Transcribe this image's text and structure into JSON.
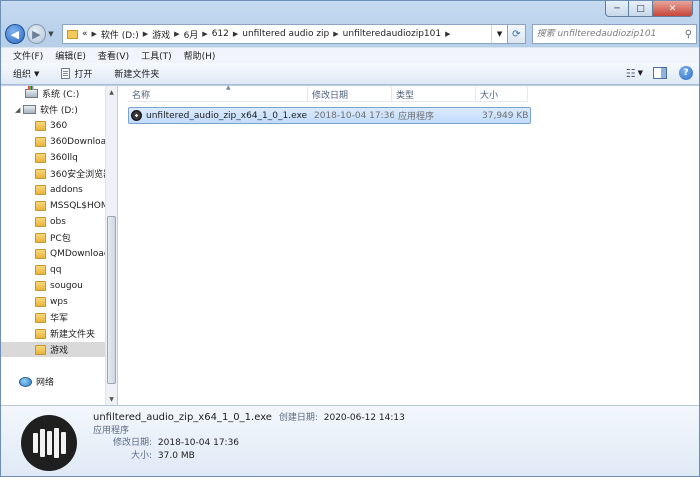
{
  "window": {
    "caption": {
      "minimize": "─",
      "maximize": "□",
      "close": "✕"
    }
  },
  "address": {
    "overflow": "«",
    "crumbs": [
      "软件 (D:)",
      "游戏",
      "6月",
      "612",
      "unfiltered audio zip",
      "unfilteredaudiozip101"
    ],
    "search_placeholder": "搜索 unfilteredaudiozip101"
  },
  "menu": {
    "items": [
      "文件(F)",
      "编辑(E)",
      "查看(V)",
      "工具(T)",
      "帮助(H)"
    ]
  },
  "toolbar": {
    "organize": "组织",
    "open": "打开",
    "new_folder": "新建文件夹"
  },
  "nav": {
    "items": [
      {
        "label": "系统 (C:)",
        "kind": "drive-sys",
        "selected": false
      },
      {
        "label": "软件 (D:)",
        "kind": "drive",
        "selected": false
      },
      {
        "label": "360",
        "kind": "folder",
        "selected": false
      },
      {
        "label": "360Downloads",
        "kind": "folder",
        "selected": false
      },
      {
        "label": "360llq",
        "kind": "folder",
        "selected": false
      },
      {
        "label": "360安全浏览器",
        "kind": "folder",
        "selected": false
      },
      {
        "label": "addons",
        "kind": "folder",
        "selected": false
      },
      {
        "label": "MSSQL$HOME",
        "kind": "folder",
        "selected": false
      },
      {
        "label": "obs",
        "kind": "folder",
        "selected": false
      },
      {
        "label": "PC包",
        "kind": "folder",
        "selected": false
      },
      {
        "label": "QMDownload",
        "kind": "folder",
        "selected": false
      },
      {
        "label": "qq",
        "kind": "folder",
        "selected": false
      },
      {
        "label": "sougou",
        "kind": "folder",
        "selected": false
      },
      {
        "label": "wps",
        "kind": "folder",
        "selected": false
      },
      {
        "label": "华军",
        "kind": "folder",
        "selected": false
      },
      {
        "label": "新建文件夹",
        "kind": "folder",
        "selected": false
      },
      {
        "label": "游戏",
        "kind": "folder",
        "selected": true
      },
      {
        "label": "网络",
        "kind": "network",
        "selected": false
      }
    ]
  },
  "columns": {
    "name": "名称",
    "modified": "修改日期",
    "type": "类型",
    "size": "大小"
  },
  "files": [
    {
      "name": "unfiltered_audio_zip_x64_1_0_1.exe",
      "modified": "2018-10-04 17:36",
      "type": "应用程序",
      "size": "37,949 KB"
    }
  ],
  "details": {
    "filename": "unfiltered_audio_zip_x64_1_0_1.exe",
    "created_label": "创建日期:",
    "created_value": "2020-06-12 14:13",
    "type": "应用程序",
    "modified_label": "修改日期:",
    "modified_value": "2018-10-04 17:36",
    "size_label": "大小:",
    "size_value": "37.0 MB"
  },
  "colors": {
    "selection": "#c1dcfc",
    "accent": "#2b6bc4"
  }
}
